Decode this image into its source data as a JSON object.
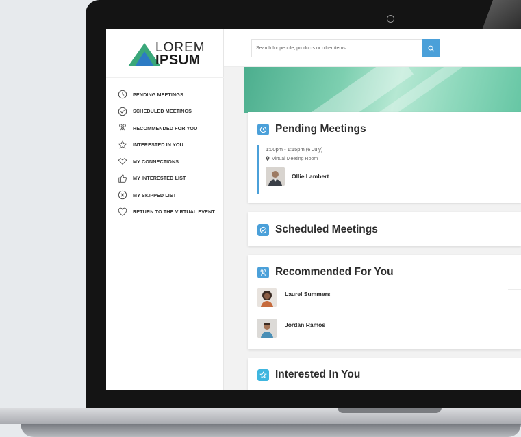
{
  "brand": {
    "line1": "LOREM",
    "line2": "IPSUM"
  },
  "sidebar": {
    "items": [
      {
        "label": "PENDING MEETINGS",
        "icon": "clock-icon"
      },
      {
        "label": "SCHEDULED MEETINGS",
        "icon": "check-circle-icon"
      },
      {
        "label": "RECOMMENDED FOR YOU",
        "icon": "people-icon"
      },
      {
        "label": "INTERESTED IN YOU",
        "icon": "star-icon"
      },
      {
        "label": "MY CONNECTIONS",
        "icon": "handshake-icon"
      },
      {
        "label": "MY INTERESTED LIST",
        "icon": "thumbs-up-icon"
      },
      {
        "label": "MY SKIPPED LIST",
        "icon": "x-circle-icon"
      },
      {
        "label": "RETURN TO THE VIRTUAL EVENT",
        "icon": "heart-icon"
      }
    ]
  },
  "search": {
    "placeholder": "Search for people, products or other items",
    "icon": "search-icon"
  },
  "pending": {
    "title": "Pending Meetings",
    "meeting": {
      "time": "1:00pm - 1:15pm (6 July)",
      "location": "Virtual Meeting Room",
      "name": "Ollie Lambert"
    }
  },
  "scheduled": {
    "title": "Scheduled Meetings"
  },
  "recommended": {
    "title": "Recommended For You",
    "people": [
      {
        "name": "Laurel Summers"
      },
      {
        "name": "Jordan Ramos"
      }
    ]
  },
  "interested": {
    "title": "Interested In You"
  },
  "colors": {
    "accent": "#4ba0d9",
    "accent_cyan": "#3fb6df",
    "brand_green": "#3aa77a"
  }
}
